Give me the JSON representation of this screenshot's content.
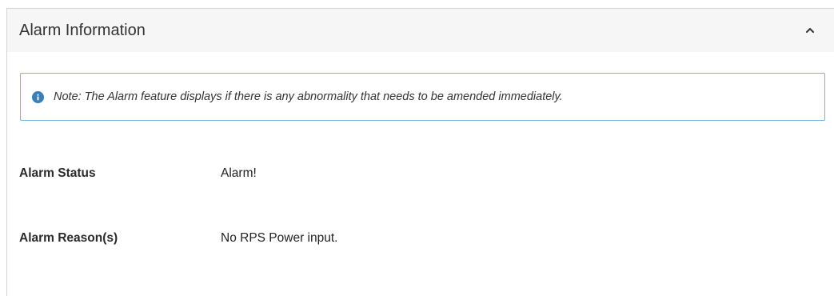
{
  "panel": {
    "title": "Alarm Information",
    "collapse_icon": "chevron-up-icon"
  },
  "note": {
    "icon": "info-icon",
    "text": "Note: The Alarm feature displays if there is any abnormality that needs to be amended immediately."
  },
  "fields": {
    "status": {
      "label": "Alarm Status",
      "value": "Alarm!"
    },
    "reasons": {
      "label": "Alarm Reason(s)",
      "value": "No RPS Power input."
    }
  },
  "colors": {
    "header_bg": "#f6f6f6",
    "note_border": "#7ab6d6",
    "info_icon": "#3a7fb5"
  }
}
